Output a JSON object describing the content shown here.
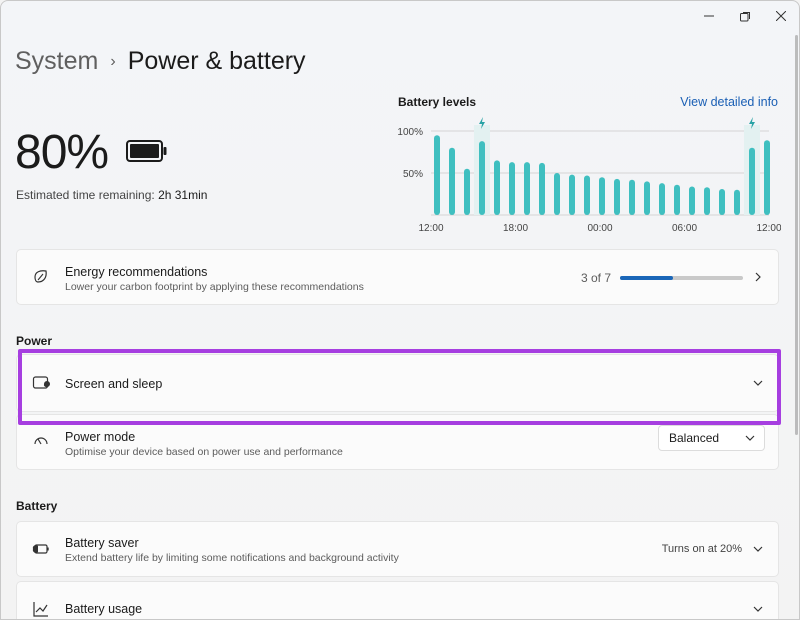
{
  "breadcrumb": {
    "parent": "System",
    "separator": "›",
    "current": "Power & battery"
  },
  "battery": {
    "percent_text": "80%",
    "percent_value": 80,
    "estimate_label": "Estimated time remaining:",
    "estimate_value": "2h 31min"
  },
  "chart_data": {
    "type": "bar",
    "title": "Battery levels",
    "link": "View detailed info",
    "y_ticks": [
      "100%",
      "50%"
    ],
    "x_ticks": [
      "12:00",
      "18:00",
      "00:00",
      "06:00",
      "12:00"
    ],
    "ylim": [
      0,
      100
    ],
    "values": [
      95,
      80,
      55,
      88,
      65,
      63,
      63,
      62,
      50,
      48,
      47,
      45,
      43,
      42,
      40,
      38,
      36,
      34,
      33,
      31,
      30,
      80,
      89
    ],
    "charging_markers_at_index": [
      3,
      21
    ],
    "color": "#3fbfc0"
  },
  "energy": {
    "title": "Energy recommendations",
    "desc": "Lower your carbon footprint by applying these recommendations",
    "progress_text": "3 of 7",
    "progress_value": 0.43
  },
  "power_section": {
    "label": "Power"
  },
  "screen_sleep": {
    "title": "Screen and sleep"
  },
  "power_mode": {
    "title": "Power mode",
    "desc": "Optimise your device based on power use and performance",
    "value": "Balanced"
  },
  "battery_section": {
    "label": "Battery"
  },
  "battery_saver": {
    "title": "Battery saver",
    "desc": "Extend battery life by limiting some notifications and background activity",
    "status": "Turns on at 20%"
  },
  "battery_usage": {
    "title": "Battery usage"
  },
  "colors": {
    "accent": "#1a66b8",
    "highlight": "#a63ee0",
    "bar": "#3fbfc0"
  }
}
